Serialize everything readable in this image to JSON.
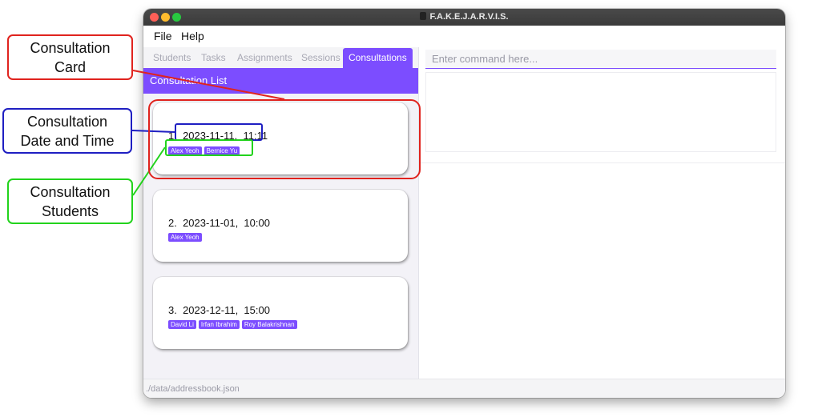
{
  "window": {
    "title": "F.A.K.E.J.A.R.V.I.S.",
    "controls": {
      "close_color": "#fe5f57",
      "minimize_color": "#febc2e",
      "zoom_color": "#28c840"
    }
  },
  "menu": {
    "file": "File",
    "help": "Help"
  },
  "tabs": [
    {
      "label": "Students",
      "active": false
    },
    {
      "label": "Tasks",
      "active": false
    },
    {
      "label": "Assignments",
      "active": false
    },
    {
      "label": "Sessions",
      "active": false
    },
    {
      "label": "Consultations",
      "active": true
    }
  ],
  "list": {
    "header": "Consultation List",
    "cards": [
      {
        "title": "1.  2023-11-11,  11:11",
        "students": [
          "Alex Yeoh",
          "Bernice Yu"
        ]
      },
      {
        "title": "2.  2023-11-01,  10:00",
        "students": [
          "Alex Yeoh"
        ]
      },
      {
        "title": "3.  2023-12-11,  15:00",
        "students": [
          "David Li",
          "Irfan Ibrahim",
          "Roy Balakrishnan"
        ]
      }
    ]
  },
  "command": {
    "placeholder": "Enter command here...",
    "value": ""
  },
  "status": {
    "path": "./data/addressbook.json"
  },
  "annotations": {
    "card": {
      "line1": "Consultation",
      "line2": "Card",
      "color": "#e0231e"
    },
    "datetime": {
      "line1": "Consultation",
      "line2": "Date and Time",
      "color": "#1f1fc2"
    },
    "students": {
      "line1": "Consultation",
      "line2": "Students",
      "color": "#22d31c"
    }
  },
  "colors": {
    "accent": "#7c4dff"
  }
}
